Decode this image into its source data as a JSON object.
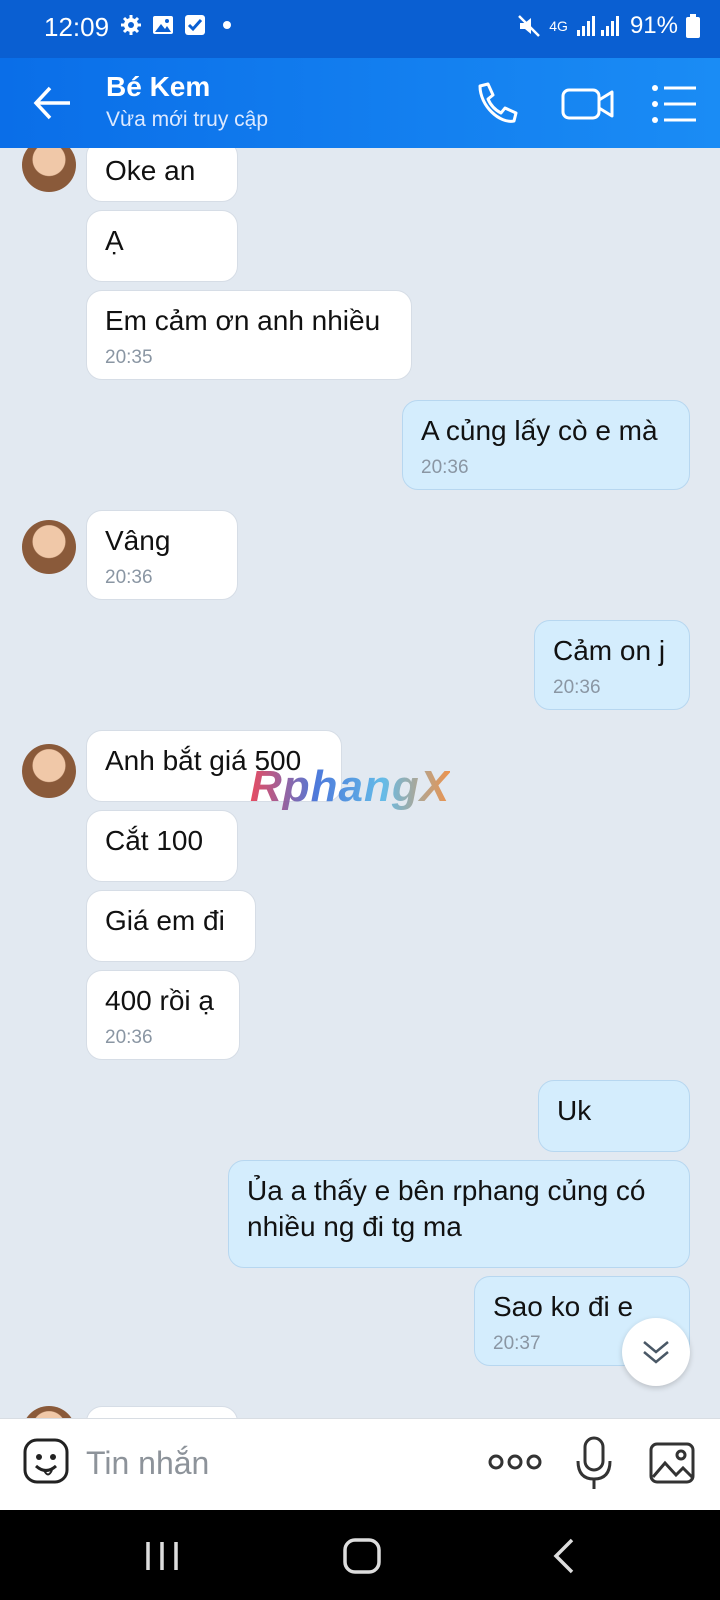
{
  "status_bar": {
    "time": "12:09",
    "network": "4G",
    "battery": "91%",
    "icons": [
      "settings-icon",
      "gallery-icon",
      "checkbox-icon",
      "dot-icon",
      "mute-icon",
      "signal-icon",
      "battery-icon"
    ]
  },
  "header": {
    "contact_name": "Bé Kem",
    "contact_status": "Vừa mới truy cập",
    "icons": [
      "back-arrow-icon",
      "phone-icon",
      "video-icon",
      "menu-list-icon"
    ]
  },
  "messages": [
    {
      "side": "in",
      "text": "Oke an",
      "time": null
    },
    {
      "side": "in",
      "text": "Ạ",
      "time": null
    },
    {
      "side": "in",
      "text": "Em cảm ơn anh nhiều",
      "time": "20:35"
    },
    {
      "side": "out",
      "text": "A củng lấy cò e mà",
      "time": "20:36"
    },
    {
      "side": "in",
      "text": "Vâng",
      "time": "20:36"
    },
    {
      "side": "out",
      "text": "Cảm on j",
      "time": "20:36"
    },
    {
      "side": "in",
      "text": "Anh bắt giá 500",
      "time": null
    },
    {
      "side": "in",
      "text": "Cắt 100",
      "time": null
    },
    {
      "side": "in",
      "text": "Giá em đi",
      "time": null
    },
    {
      "side": "in",
      "text": "400 rồi ạ",
      "time": "20:36"
    },
    {
      "side": "out",
      "text": "Uk",
      "time": null
    },
    {
      "side": "out",
      "text": "Ủa a thấy e bên rphang củng có nhiều ng đi tg ma",
      "time": null
    },
    {
      "side": "out",
      "text": "Sao ko đi e",
      "time": "20:37"
    }
  ],
  "watermark": "RphangX",
  "composer": {
    "placeholder": "Tin nhắn",
    "icons": [
      "emoji-icon",
      "more-dots-icon",
      "microphone-icon",
      "image-icon"
    ]
  },
  "nav_bar": {
    "icons": [
      "recent-apps-icon",
      "home-icon",
      "back-icon"
    ]
  },
  "colors": {
    "header": "#1a8cf5",
    "status_bar": "#0a5fd2",
    "chat_bg": "#e2e9f1",
    "incoming_bubble": "#ffffff",
    "outgoing_bubble": "#d4edfd"
  }
}
